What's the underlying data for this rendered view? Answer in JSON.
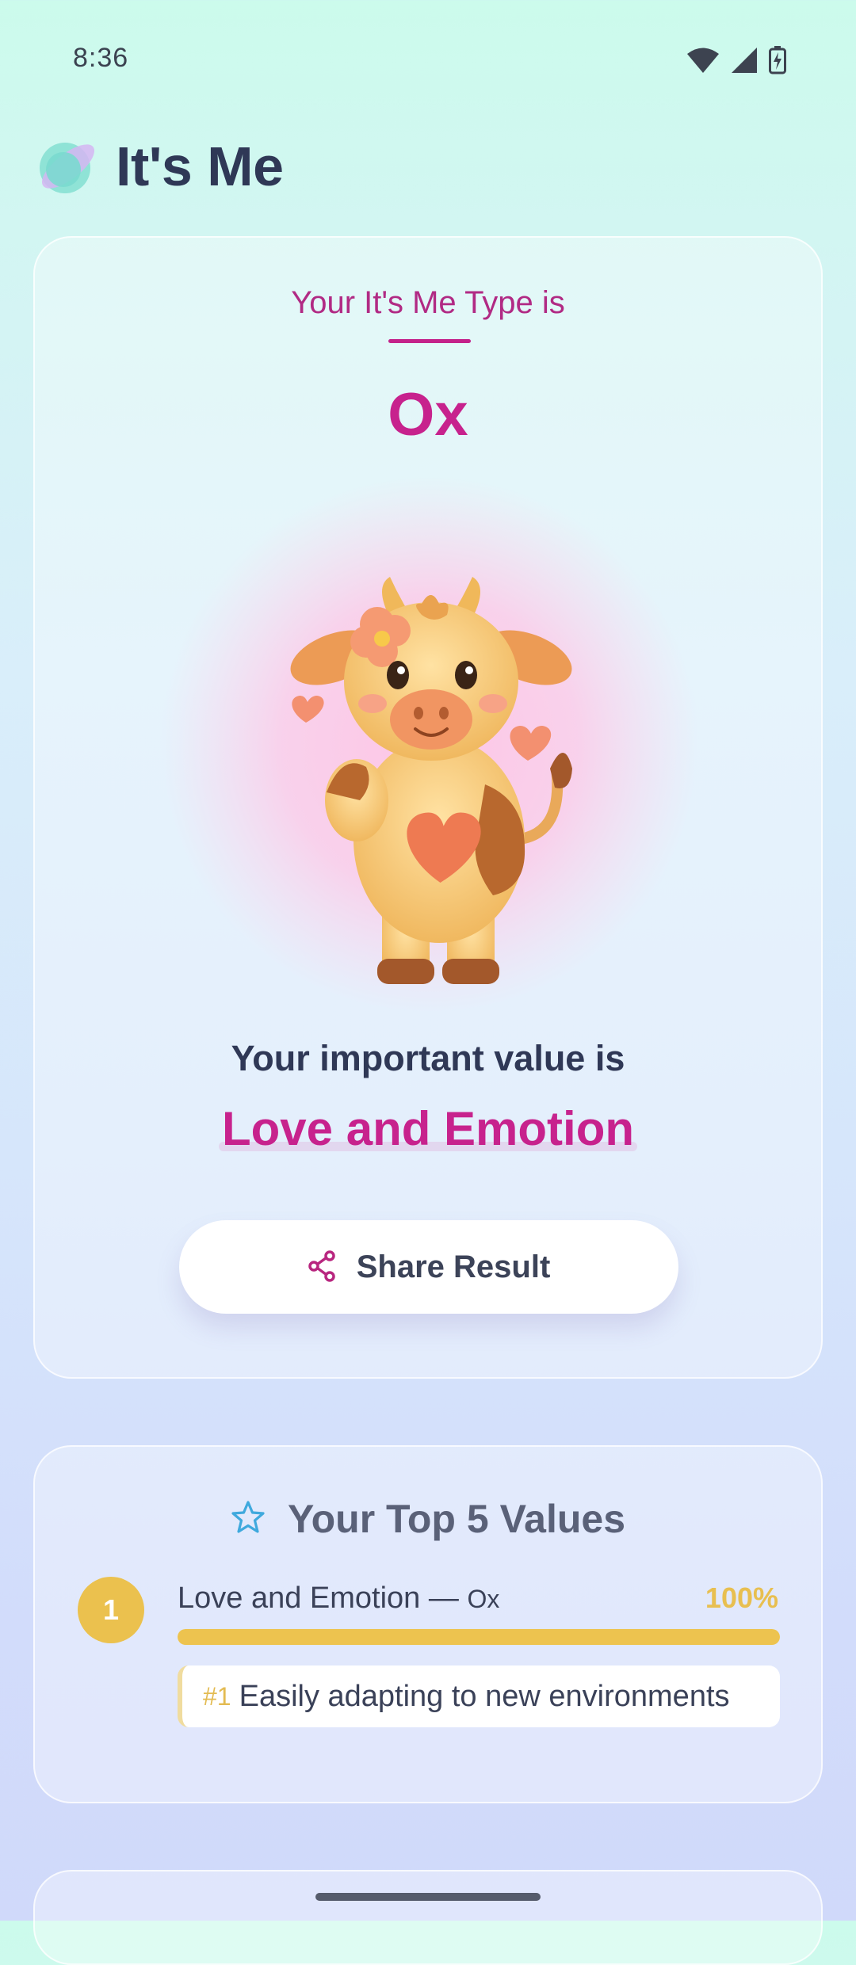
{
  "status_bar": {
    "time": "8:36"
  },
  "header": {
    "app_title": "It's Me"
  },
  "result": {
    "intro": "Your It's Me Type is",
    "type_name": "Ox",
    "value_intro": "Your important value is",
    "value_name": "Love and Emotion",
    "share_label": "Share Result"
  },
  "top_values": {
    "title": "Your Top 5 Values",
    "items": [
      {
        "rank": "1",
        "label": "Love and Emotion —",
        "type": "Ox",
        "percent_text": "100%",
        "percent": 100,
        "trait_number": "#1",
        "trait": "Easily adapting to new environments"
      }
    ]
  },
  "colors": {
    "accent": "#c7228d",
    "gold": "#ebc14e",
    "title_text": "#2f3856"
  }
}
